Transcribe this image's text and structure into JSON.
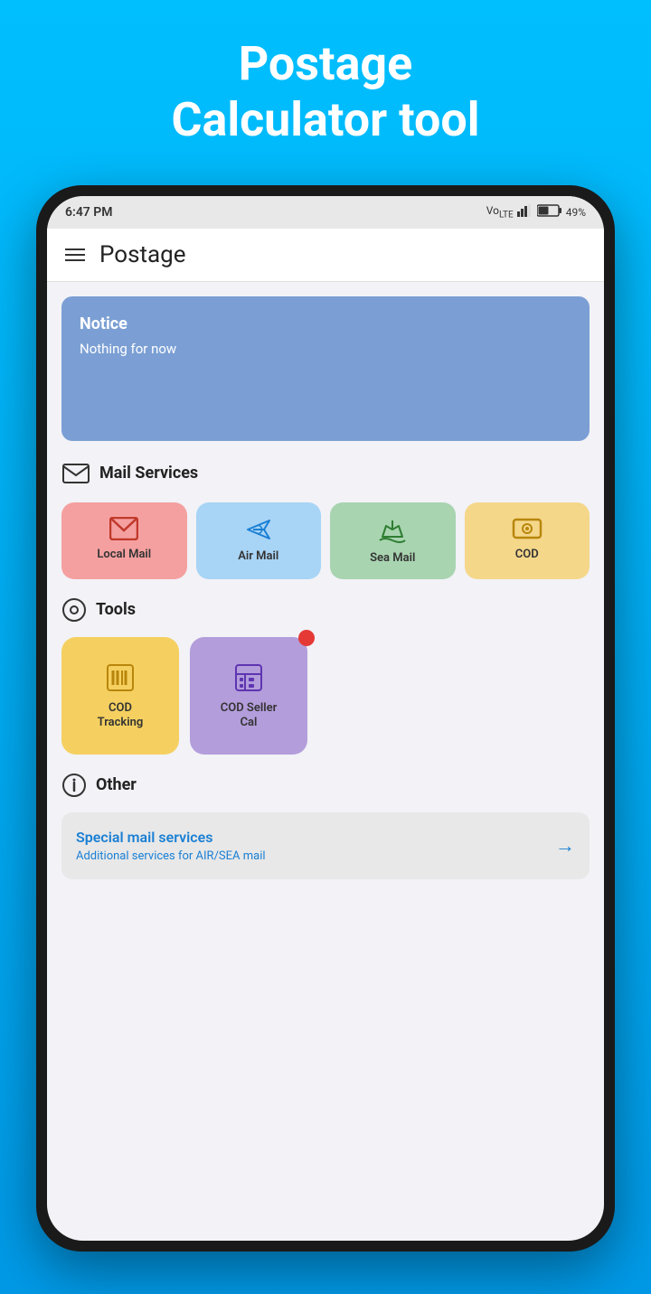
{
  "header": {
    "title_line1": "Postage",
    "title_line2": "Calculator tool"
  },
  "status_bar": {
    "time": "6:47 PM",
    "signal": "Vo LTE ▌▌▌",
    "battery": "49%"
  },
  "app_header": {
    "title": "Postage"
  },
  "notice": {
    "title": "Notice",
    "body": "Nothing for now"
  },
  "mail_services": {
    "section_label": "Mail Services",
    "items": [
      {
        "id": "local-mail",
        "label": "Local Mail",
        "color": "#f5a0a0",
        "icon_type": "envelope"
      },
      {
        "id": "air-mail",
        "label": "Air Mail",
        "color": "#a8d4f5",
        "icon_type": "plane"
      },
      {
        "id": "sea-mail",
        "label": "Sea Mail",
        "color": "#a8d4b0",
        "icon_type": "ship"
      },
      {
        "id": "cod",
        "label": "COD",
        "color": "#f5d78a",
        "icon_type": "money"
      }
    ]
  },
  "tools": {
    "section_label": "Tools",
    "items": [
      {
        "id": "cod-tracking",
        "label": "COD\nTracking",
        "label_line1": "COD",
        "label_line2": "Tracking",
        "color": "#f5d060",
        "has_notification": false
      },
      {
        "id": "cod-seller-cal",
        "label": "COD Seller Cal",
        "label_line1": "COD Seller",
        "label_line2": "Cal",
        "color": "#b39ddb",
        "has_notification": true
      }
    ]
  },
  "other": {
    "section_label": "Other",
    "special_card": {
      "title": "Special mail services",
      "subtitle": "Additional services for AIR/SEA mail"
    }
  }
}
